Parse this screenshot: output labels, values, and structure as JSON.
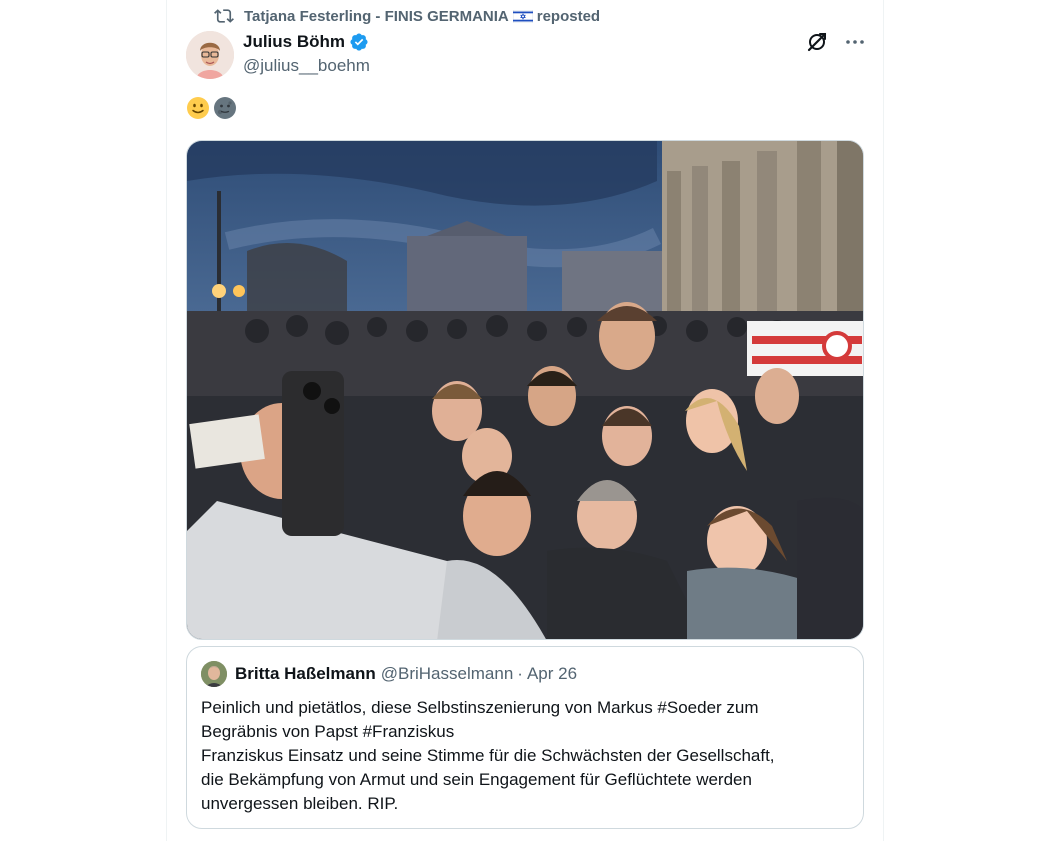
{
  "repost": {
    "icon": "repost-icon",
    "user": "Tatjana Festerling - FINIS GERMANIA",
    "flag": "israel-flag",
    "suffix": "reposted"
  },
  "post": {
    "display_name": "Julius Böhm",
    "verified_icon": "verified-badge-icon",
    "handle": "@julius__boehm",
    "text_emojis": [
      "slightly-smiling-face-emoji",
      "new-moon-face-emoji"
    ],
    "top_actions": [
      "grok-icon",
      "more-icon"
    ],
    "media": {
      "kind": "photo",
      "subject": "group-selfie-crowd-brandenburg-gate-dusk"
    }
  },
  "quoted": {
    "display_name": "Britta Haßelmann",
    "handle": "@BriHasselmann",
    "separator": "·",
    "date": "Apr 26",
    "lines": [
      "Peinlich und pietätlos, diese Selbstinszenierung von Markus #Soeder zum",
      "Begräbnis von Papst #Franziskus",
      "Franziskus Einsatz und seine Stimme für die Schwächsten der Gesellschaft,",
      "die Bekämpfung von Armut und sein Engagement für Geflüchtete werden",
      "unvergessen bleiben. RIP."
    ]
  },
  "colors": {
    "text": "#0f1419",
    "secondary": "#536471",
    "border": "#cfd9de",
    "verified": "#1d9bf0"
  }
}
